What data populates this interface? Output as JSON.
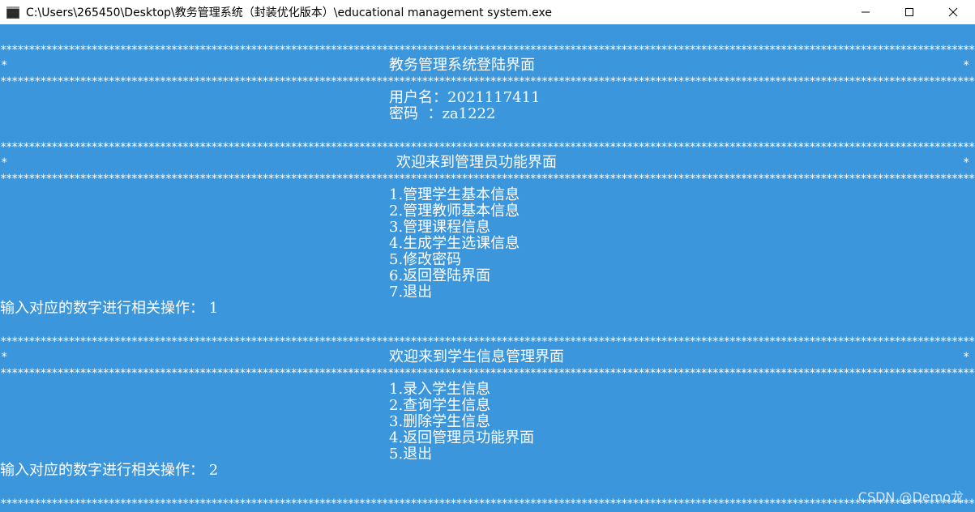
{
  "window": {
    "title": "C:\\Users\\265450\\Desktop\\教务管理系统（封装优化版本）\\educational management system.exe",
    "controls": {
      "minimize_icon": "minimize-icon",
      "maximize_icon": "maximize-icon",
      "close_icon": "close-icon"
    }
  },
  "colors": {
    "console_bg": "#3c96dc",
    "console_fg": "#ffffff",
    "titlebar_bg": "#ffffff"
  },
  "console": {
    "star_row": "****************************************************************************************************************************************************************************************",
    "edge_star": "*",
    "login": {
      "heading": "教务管理系统登陆界面",
      "username_line": "用户名：2021117411",
      "password_line": "密码  ：za1222"
    },
    "admin_menu": {
      "heading": "欢迎来到管理员功能界面",
      "items": [
        "1.管理学生基本信息",
        "2.管理教师基本信息",
        "3.管理课程信息",
        "4.生成学生选课信息",
        "5.修改密码",
        "6.返回登陆界面",
        "7.退出"
      ],
      "prompt": "输入对应的数字进行相关操作： 1"
    },
    "student_menu": {
      "heading": "欢迎来到学生信息管理界面",
      "items": [
        "1.录入学生信息",
        "2.查询学生信息",
        "3.删除学生信息",
        "4.返回管理员功能界面",
        "5.退出"
      ],
      "prompt": "输入对应的数字进行相关操作： 2"
    }
  },
  "watermark": "CSDN @Demo龙"
}
